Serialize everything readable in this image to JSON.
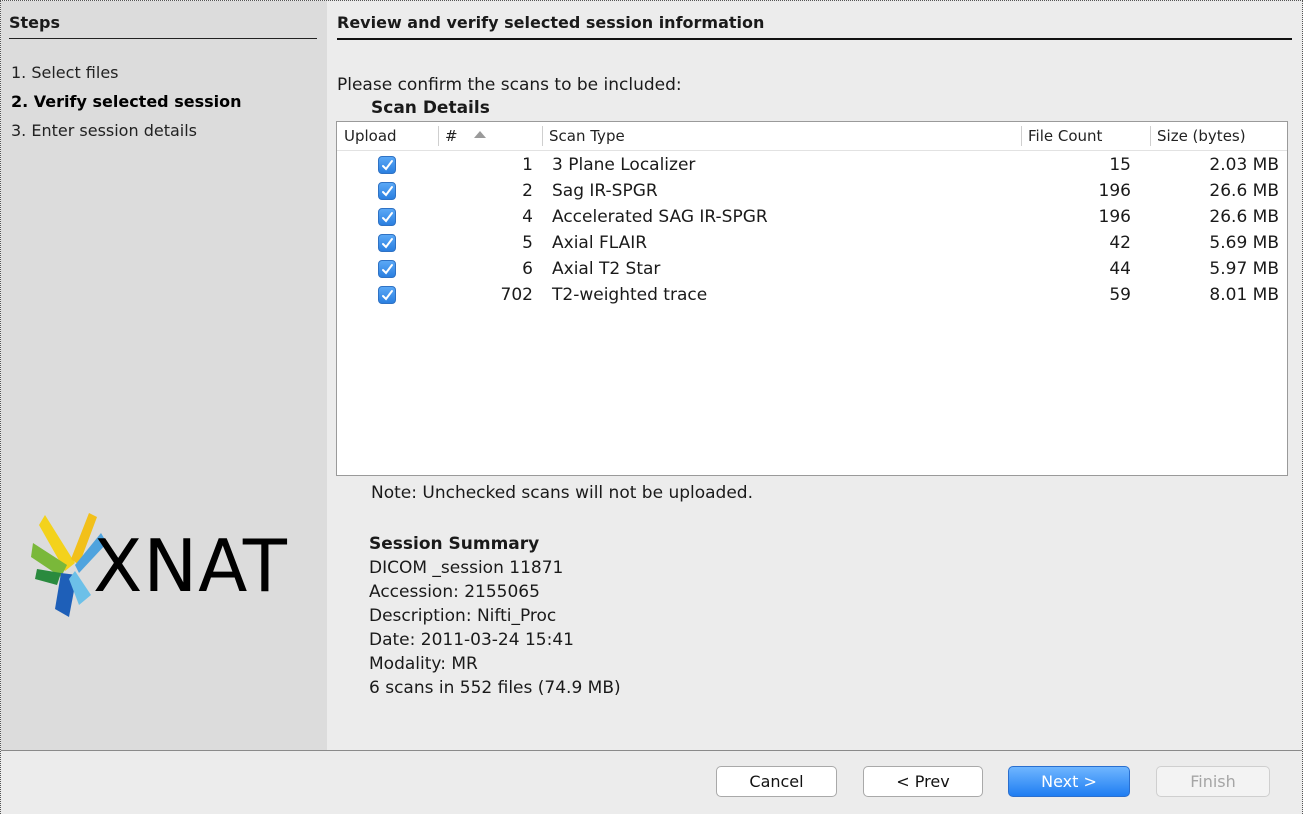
{
  "steps": {
    "title": "Steps",
    "items": [
      {
        "label": "1. Select files",
        "active": false
      },
      {
        "label": "2. Verify selected session",
        "active": true
      },
      {
        "label": "3. Enter session details",
        "active": false
      }
    ],
    "logo_text": "XNAT"
  },
  "main": {
    "title": "Review and verify selected session information",
    "confirm_text": "Please confirm the scans to be included:",
    "scan_details_title": "Scan Details",
    "columns": {
      "upload": "Upload",
      "num": "#",
      "scan_type": "Scan Type",
      "file_count": "File Count",
      "size": "Size (bytes)"
    },
    "rows": [
      {
        "checked": true,
        "num": "1",
        "type": "3 Plane Localizer",
        "count": "15",
        "size": "2.03 MB"
      },
      {
        "checked": true,
        "num": "2",
        "type": "Sag IR-SPGR",
        "count": "196",
        "size": "26.6 MB"
      },
      {
        "checked": true,
        "num": "4",
        "type": "Accelerated SAG IR-SPGR",
        "count": "196",
        "size": "26.6 MB"
      },
      {
        "checked": true,
        "num": "5",
        "type": "Axial FLAIR",
        "count": "42",
        "size": "5.69 MB"
      },
      {
        "checked": true,
        "num": "6",
        "type": "Axial T2 Star",
        "count": "44",
        "size": "5.97 MB"
      },
      {
        "checked": true,
        "num": "702",
        "type": "T2-weighted trace",
        "count": "59",
        "size": "8.01 MB"
      }
    ],
    "note": "Note: Unchecked scans will not be uploaded.",
    "summary": {
      "title": "Session Summary",
      "session": "DICOM _session 11871",
      "accession": "Accession: 2155065",
      "description": "Description: Nifti_Proc",
      "date": "Date: 2011-03-24 15:41",
      "modality": "Modality: MR",
      "totals": "6 scans in 552 files (74.9 MB)"
    }
  },
  "buttons": {
    "cancel": "Cancel",
    "prev": "< Prev",
    "next": "Next >",
    "finish": "Finish"
  },
  "colors": {
    "accent": "#2a7fe0",
    "sidebar_bg": "#dcdcdc",
    "panel_bg": "#ececec"
  }
}
